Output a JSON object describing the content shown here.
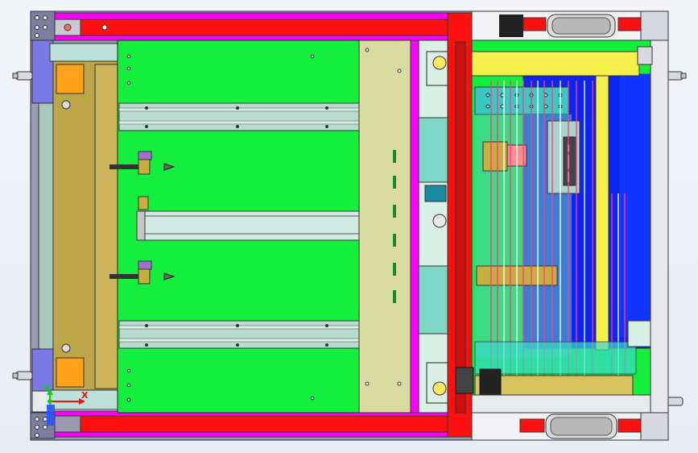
{
  "viewport": {
    "background": "#eef1f6"
  },
  "colors": {
    "frame": "#7d7d9a",
    "frame_dark": "#2f2f4a",
    "main_plate": "#14ee3c",
    "red_bar": "#ff1010",
    "magenta": "#ff00ff",
    "olive": "#c8ab4a",
    "pale_olive": "#d9dca0",
    "steel": "#b9dcd2",
    "blue": "#0a26f0",
    "yellow": "#f5f04a",
    "orange": "#ffa21a",
    "purple": "#a070d0",
    "teal_block": "#39c9c0"
  },
  "triad": {
    "x_label": "X",
    "y_label": "Y"
  },
  "side_plate": {
    "text": "▬▬▬ ▬▬▬▬ ▬▬"
  },
  "icons": {
    "triad": "xyz-triad-icon",
    "bolt": "bolt-icon",
    "wheel": "wheel-icon"
  }
}
